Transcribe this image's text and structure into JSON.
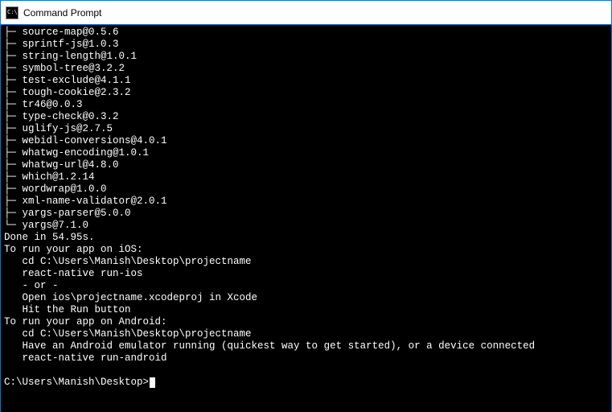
{
  "window": {
    "title": "Command Prompt"
  },
  "packages": [
    "source-map@0.5.6",
    "sprintf-js@1.0.3",
    "string-length@1.0.1",
    "symbol-tree@3.2.2",
    "test-exclude@4.1.1",
    "tough-cookie@2.3.2",
    "tr46@0.0.3",
    "type-check@0.3.2",
    "uglify-js@2.7.5",
    "webidl-conversions@4.0.1",
    "whatwg-encoding@1.0.1",
    "whatwg-url@4.8.0",
    "which@1.2.14",
    "wordwrap@1.0.0",
    "xml-name-validator@2.0.1",
    "yargs-parser@5.0.0",
    "yargs@7.1.0"
  ],
  "done_line": "Done in 54.95s.",
  "ios": {
    "header": "To run your app on iOS:",
    "lines": [
      "   cd C:\\Users\\Manish\\Desktop\\projectname",
      "   react-native run-ios",
      "   - or -",
      "   Open ios\\projectname.xcodeproj in Xcode",
      "   Hit the Run button"
    ]
  },
  "android": {
    "header": "To run your app on Android:",
    "lines": [
      "   cd C:\\Users\\Manish\\Desktop\\projectname",
      "   Have an Android emulator running (quickest way to get started), or a device connected",
      "   react-native run-android"
    ]
  },
  "prompt": "C:\\Users\\Manish\\Desktop>"
}
